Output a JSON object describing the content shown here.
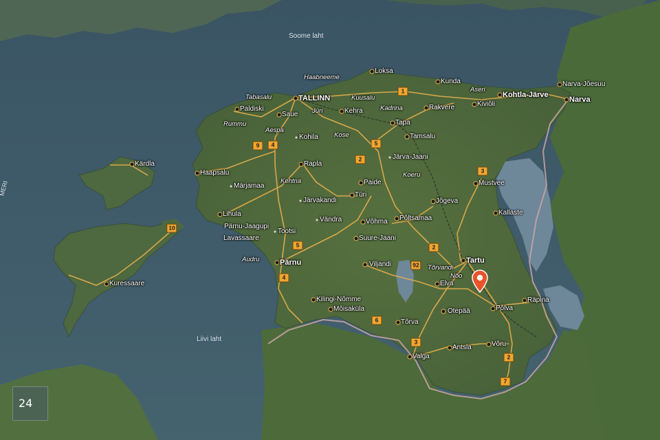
{
  "map": {
    "water_labels": {
      "gulf_finland": "Soome laht",
      "gulf_riga": "Liivi laht",
      "sea_edge": "MERI"
    },
    "cities": {
      "tallinn": "TALLINN",
      "tartu": "Tartu",
      "narva": "Narva",
      "parnu": "Pärnu",
      "kohtla_jarve": "Kohtla-Järve",
      "narva_joesuu": "Narva-Jõesuu",
      "kivioli": "Kiviõli",
      "rakvere": "Rakvere",
      "kunda": "Kunda",
      "loksa": "Loksa",
      "kehra": "Kehra",
      "tapa": "Tapa",
      "tamsalu": "Tamsalu",
      "paldiski": "Paldiski",
      "saue": "Saue",
      "haapsalu": "Haapsalu",
      "kardla": "Kärdla",
      "rapla": "Rapla",
      "paide": "Paide",
      "turi": "Türi",
      "jogeva": "Jõgeva",
      "mustvee": "Mustvee",
      "kallaste": "Kallaste",
      "poltsamaa": "Põltsamaa",
      "vohma": "Võhma",
      "suure_jaani": "Suure-Jaani",
      "viljandi": "Viljandi",
      "elva": "Elva",
      "polva": "Põlva",
      "rapina": "Räpina",
      "otepaa": "Otepää",
      "voru": "Võru",
      "antsla": "Antsla",
      "torva": "Tõrva",
      "valga": "Valga",
      "kuressaare": "Kuressaare",
      "lihula": "Lihula",
      "kilingi_nomme": "Kilingi-Nõmme",
      "moisakula": "Mõisaküla",
      "marjamaa": "Märjamaa",
      "jarvakandi": "Järvakandi",
      "vandra": "Vändra",
      "kohila": "Kohila",
      "lavassaare": "Lavassaare",
      "pamu_jaagupi": "Pärnu-Jaagupi",
      "tootsi": "Tootsi",
      "jarva_jaani": "Järva-Jaani"
    },
    "villages": {
      "haabneeme": "Haabneeme",
      "tabasalu": "Tabasalu",
      "juri": "Jüri",
      "kuusalu": "Kuusalu",
      "kadrina": "Kadrina",
      "aseri": "Aseri",
      "rummu": "Rummu",
      "aespa": "Aespa",
      "kose": "Kose",
      "kehtna": "Kehtna",
      "koeru": "Koeru",
      "audru": "Audru",
      "torvandi": "Tõrvandi",
      "noo": "Nõo"
    },
    "road_numbers": [
      "1",
      "2",
      "3",
      "4",
      "5",
      "6",
      "7",
      "9",
      "10",
      "92",
      "2",
      "2",
      "3",
      "4",
      "5",
      "3"
    ],
    "zoom_level": "24",
    "colors": {
      "sea": "#3f5a6a",
      "land": "#4f6a40",
      "road": "#e8b04c",
      "border": "#c9a6a6",
      "pin": "#e8542a",
      "lake": "#6e8799"
    }
  }
}
